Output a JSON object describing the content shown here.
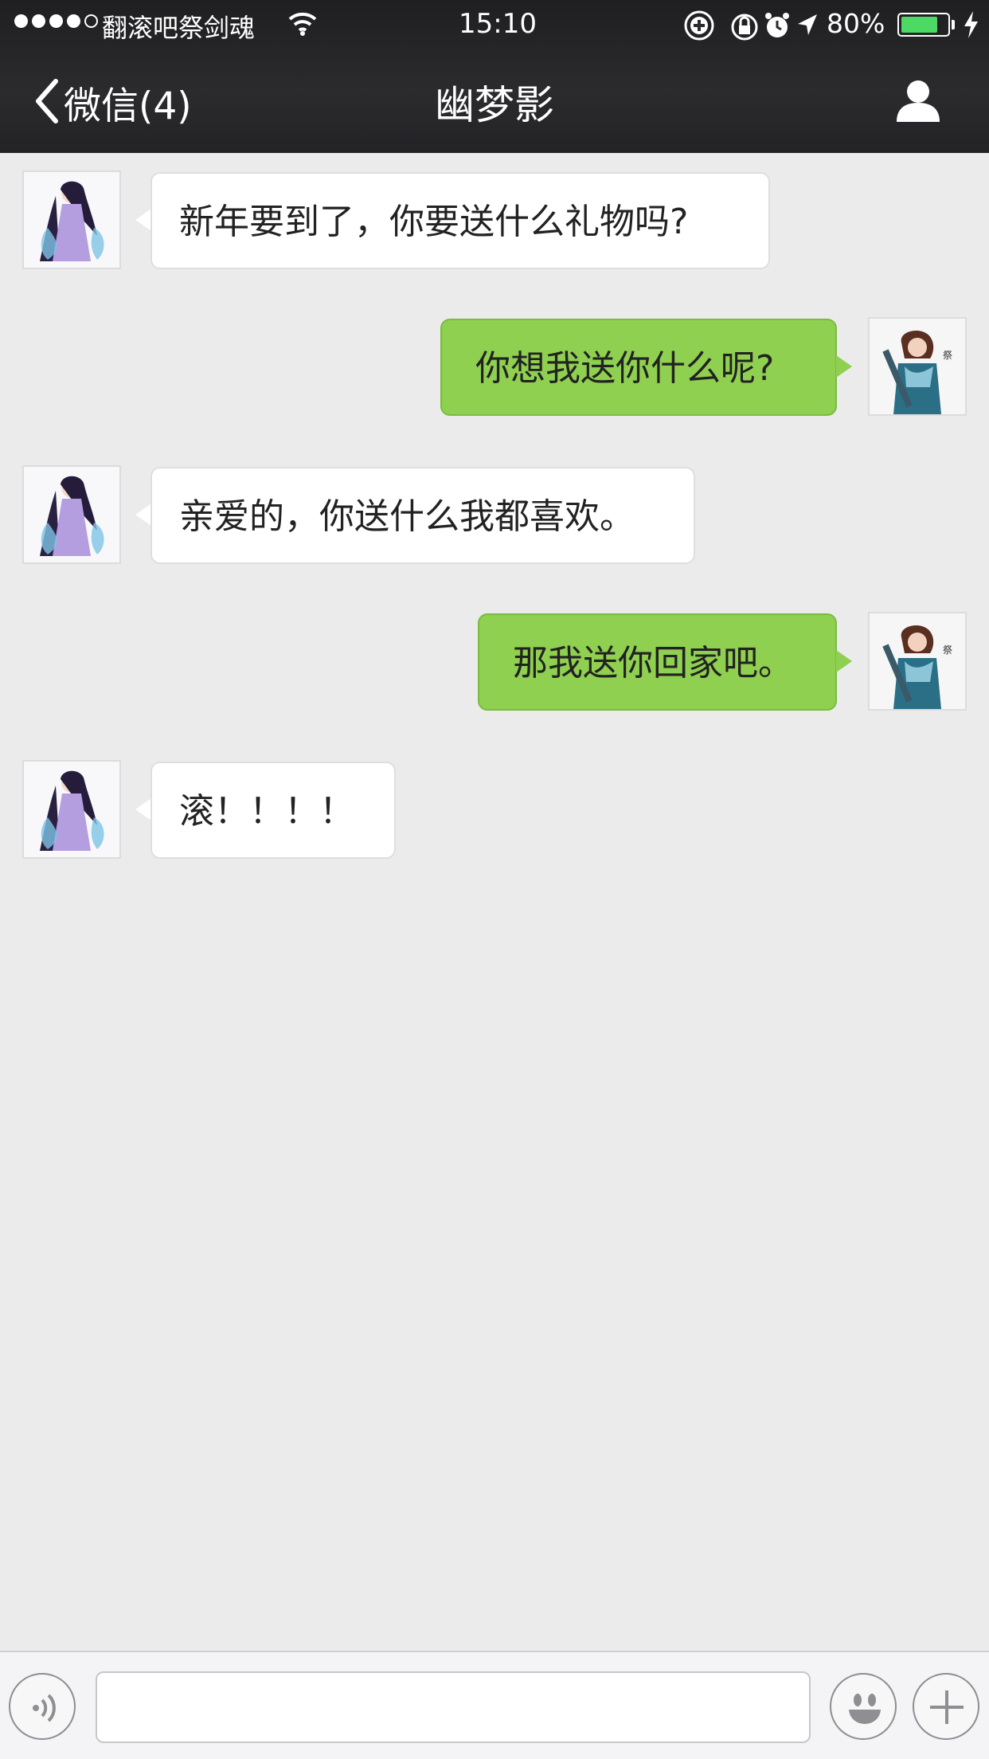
{
  "status_bar": {
    "carrier": "翻滚吧祭剑魂",
    "time": "15:10",
    "battery_percent": "80%",
    "battery_level": 0.8,
    "battery_color": "#4cd964",
    "icons": [
      "signal-dots",
      "wifi-icon",
      "rotation-lock-icon",
      "lock-icon",
      "alarm-icon",
      "location-arrow-icon",
      "battery-icon",
      "charging-bolt-icon"
    ]
  },
  "nav": {
    "back_label": "微信(4)",
    "title": "幽梦影",
    "right_icon": "profile-icon"
  },
  "messages": [
    {
      "side": "in",
      "text": "新年要到了，你要送什么礼物吗?"
    },
    {
      "side": "out",
      "text": "你想我送你什么呢?"
    },
    {
      "side": "in",
      "text": "亲爱的，你送什么我都喜欢。"
    },
    {
      "side": "out",
      "text": "那我送你回家吧。"
    },
    {
      "side": "in",
      "text": "滚！！！！"
    }
  ],
  "input_bar": {
    "voice_icon": "voice-icon",
    "text_value": "",
    "emoji_icon": "emoji-icon",
    "add_icon": "plus-icon"
  },
  "colors": {
    "outgoing_bubble": "#8fd050",
    "incoming_bubble": "#ffffff",
    "background": "#ebebeb",
    "nav_bar": "#2b2b2e"
  }
}
